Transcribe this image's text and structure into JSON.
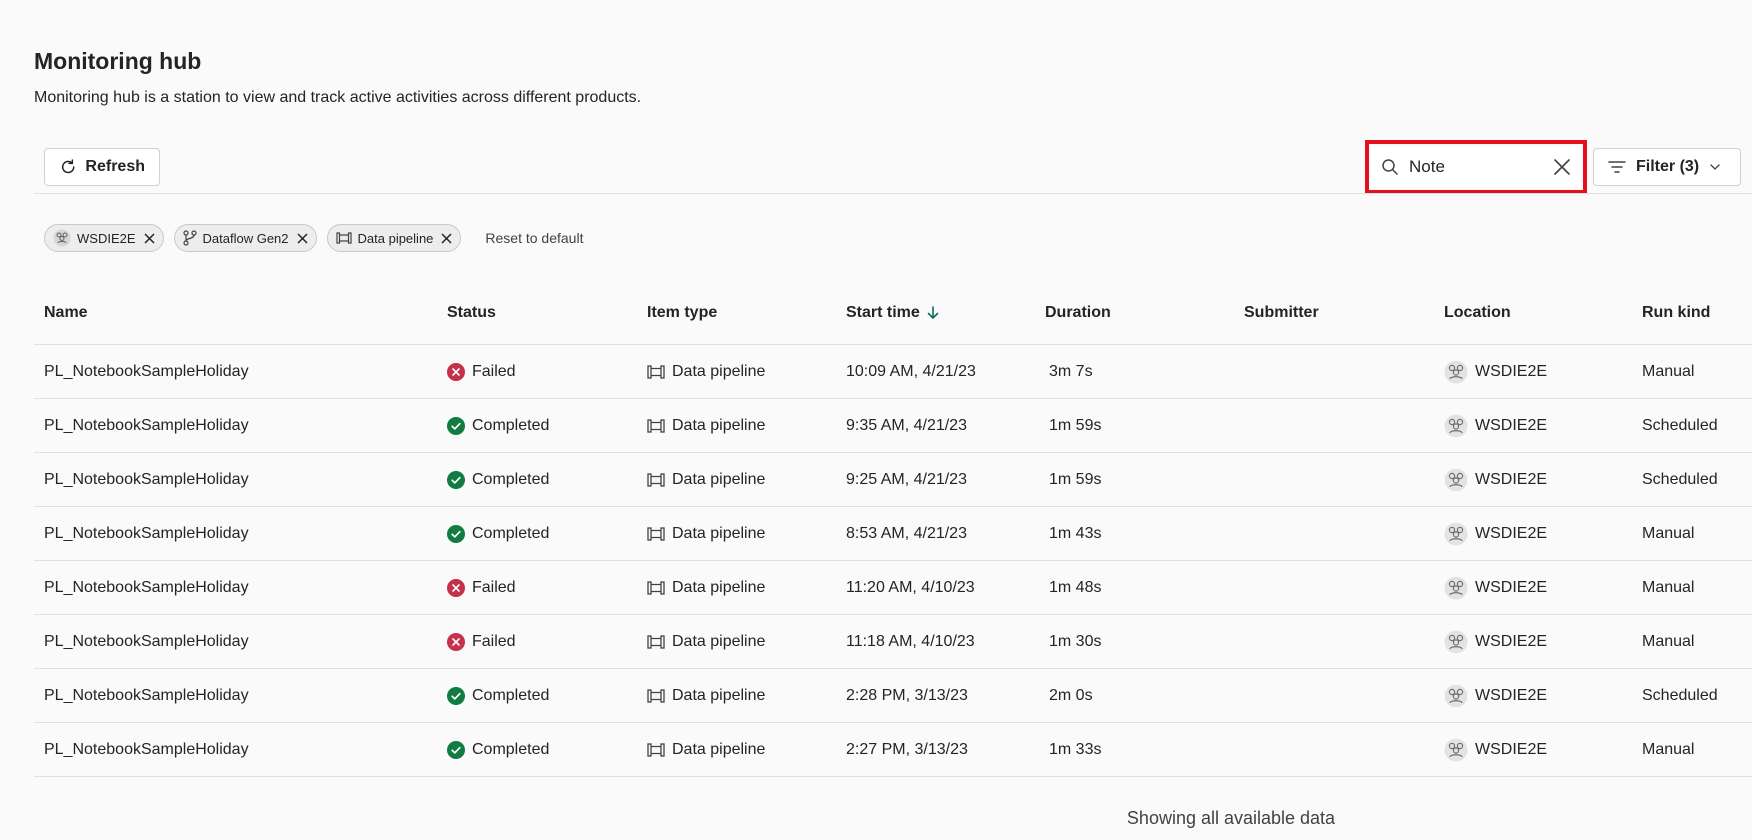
{
  "header": {
    "title": "Monitoring hub",
    "subtitle": "Monitoring hub is a station to view and track active activities across different products."
  },
  "toolbar": {
    "refresh_label": "Refresh",
    "search_value": "Note",
    "filter_label": "Filter (3)"
  },
  "chips": {
    "workspace": "WSDIE2E",
    "dataflow": "Dataflow Gen2",
    "pipeline": "Data pipeline",
    "reset_label": "Reset to default"
  },
  "columns": {
    "name": "Name",
    "status": "Status",
    "item_type": "Item type",
    "start_time": "Start time",
    "duration": "Duration",
    "submitter": "Submitter",
    "location": "Location",
    "run_kind": "Run kind"
  },
  "rows": [
    {
      "name": "PL_NotebookSampleHoliday",
      "status": "Failed",
      "item_type": "Data pipeline",
      "start_time": "10:09 AM, 4/21/23",
      "duration": "3m 7s",
      "submitter": "",
      "location": "WSDIE2E",
      "run_kind": "Manual"
    },
    {
      "name": "PL_NotebookSampleHoliday",
      "status": "Completed",
      "item_type": "Data pipeline",
      "start_time": "9:35 AM, 4/21/23",
      "duration": "1m 59s",
      "submitter": "",
      "location": "WSDIE2E",
      "run_kind": "Scheduled"
    },
    {
      "name": "PL_NotebookSampleHoliday",
      "status": "Completed",
      "item_type": "Data pipeline",
      "start_time": "9:25 AM, 4/21/23",
      "duration": "1m 59s",
      "submitter": "",
      "location": "WSDIE2E",
      "run_kind": "Scheduled"
    },
    {
      "name": "PL_NotebookSampleHoliday",
      "status": "Completed",
      "item_type": "Data pipeline",
      "start_time": "8:53 AM, 4/21/23",
      "duration": "1m 43s",
      "submitter": "",
      "location": "WSDIE2E",
      "run_kind": "Manual"
    },
    {
      "name": "PL_NotebookSampleHoliday",
      "status": "Failed",
      "item_type": "Data pipeline",
      "start_time": "11:20 AM, 4/10/23",
      "duration": "1m 48s",
      "submitter": "",
      "location": "WSDIE2E",
      "run_kind": "Manual"
    },
    {
      "name": "PL_NotebookSampleHoliday",
      "status": "Failed",
      "item_type": "Data pipeline",
      "start_time": "11:18 AM, 4/10/23",
      "duration": "1m 30s",
      "submitter": "",
      "location": "WSDIE2E",
      "run_kind": "Manual"
    },
    {
      "name": "PL_NotebookSampleHoliday",
      "status": "Completed",
      "item_type": "Data pipeline",
      "start_time": "2:28 PM, 3/13/23",
      "duration": "2m 0s",
      "submitter": "",
      "location": "WSDIE2E",
      "run_kind": "Scheduled"
    },
    {
      "name": "PL_NotebookSampleHoliday",
      "status": "Completed",
      "item_type": "Data pipeline",
      "start_time": "2:27 PM, 3/13/23",
      "duration": "1m 33s",
      "submitter": "",
      "location": "WSDIE2E",
      "run_kind": "Manual"
    }
  ],
  "footer": {
    "text": "Showing all available data"
  },
  "colors": {
    "failed": "#c4314b",
    "completed": "#107c41",
    "highlight": "#e3101e",
    "sort_arrow": "#0f6c5a"
  },
  "icons": {
    "refresh": "refresh-icon",
    "search": "search-icon",
    "clear": "close-icon",
    "filter": "filter-icon",
    "workspace": "workspace-icon",
    "dataflow": "dataflow-icon",
    "pipeline": "pipeline-icon",
    "sort": "arrow-down-icon",
    "failed": "failed-icon",
    "completed": "completed-icon"
  }
}
